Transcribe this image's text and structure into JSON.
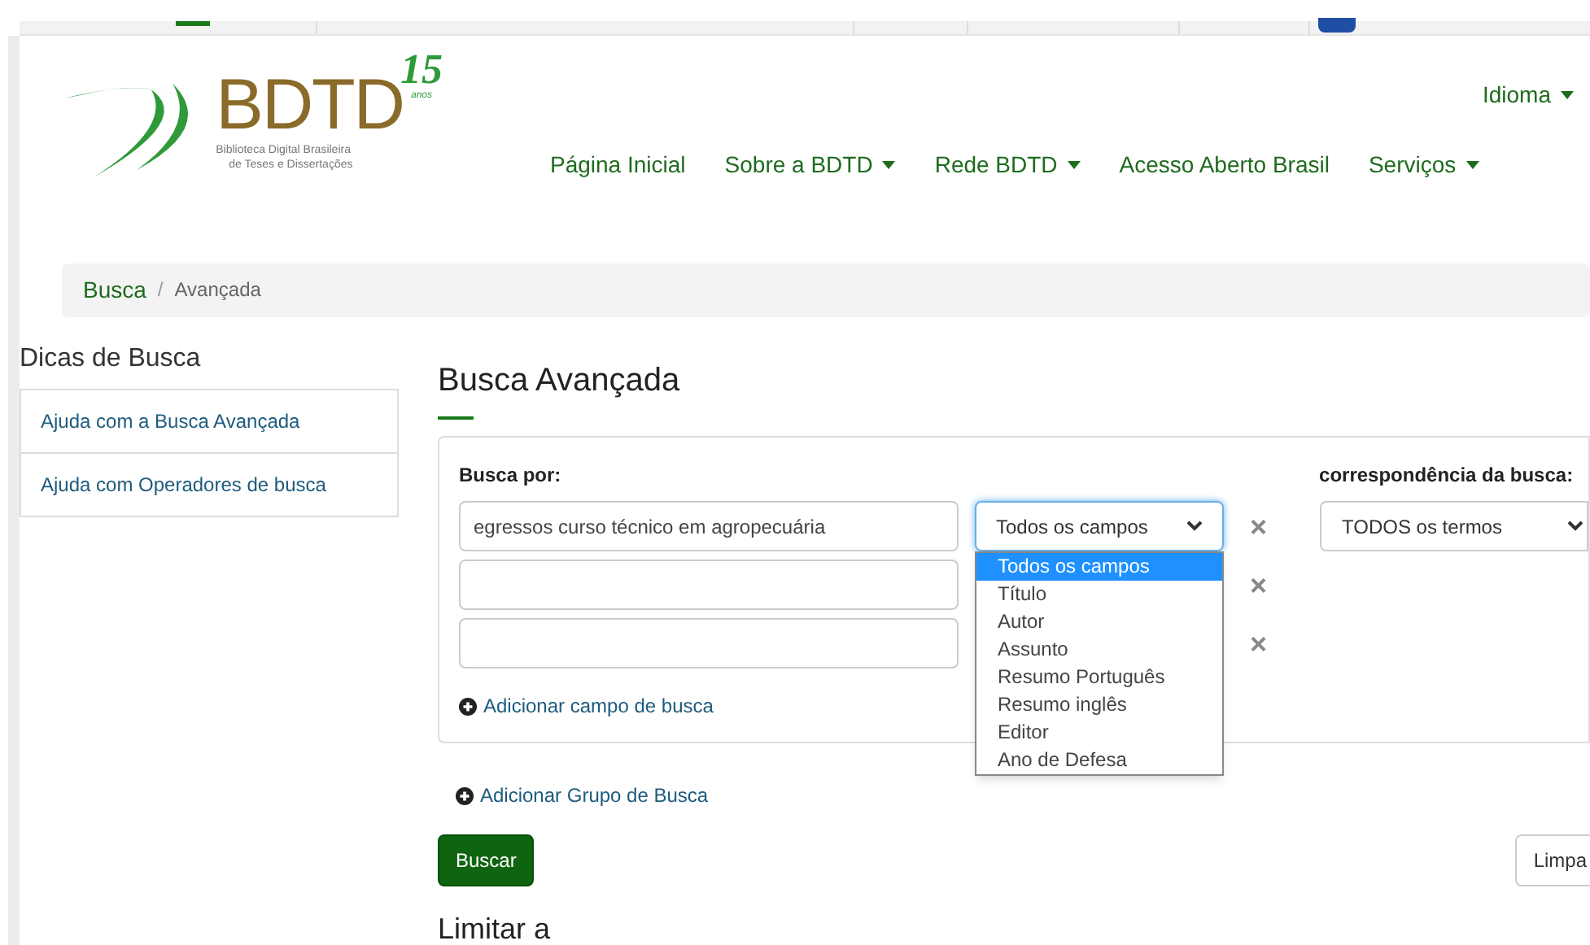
{
  "logo": {
    "name": "BDTD",
    "anniversary": "15",
    "anniversary_word": "anos",
    "subtitle_1": "Biblioteca Digital Brasileira",
    "subtitle_2": "de Teses e Dissertações"
  },
  "language_menu": {
    "label": "Idioma"
  },
  "nav": [
    {
      "label": "Página Inicial",
      "dropdown": false
    },
    {
      "label": "Sobre a BDTD",
      "dropdown": true
    },
    {
      "label": "Rede BDTD",
      "dropdown": true
    },
    {
      "label": "Acesso Aberto Brasil",
      "dropdown": false
    },
    {
      "label": "Serviços",
      "dropdown": true
    }
  ],
  "breadcrumb_separator": "/",
  "breadcrumb": [
    {
      "label": "Busca",
      "link": true
    },
    {
      "label": "Avançada",
      "link": false
    }
  ],
  "sidebar": {
    "title": "Dicas de Busca",
    "items": [
      "Ajuda com a Busca Avançada",
      "Ajuda com Operadores de busca"
    ]
  },
  "main": {
    "title": "Busca Avançada",
    "search_label": "Busca por:",
    "terms": [
      {
        "value": "egressos curso técnico em agropecuária",
        "field": "Todos os campos",
        "open": true,
        "removable": true
      },
      {
        "removable": true
      },
      {
        "removable": true
      }
    ],
    "field_options": [
      {
        "label": "Todos os campos",
        "selected": true
      },
      {
        "label": "Título",
        "selected": false
      },
      {
        "label": "Autor",
        "selected": false
      },
      {
        "label": "Assunto",
        "selected": false
      },
      {
        "label": "Resumo Português",
        "selected": false
      },
      {
        "label": "Resumo inglês",
        "selected": false
      },
      {
        "label": "Editor",
        "selected": false
      },
      {
        "label": "Ano de Defesa",
        "selected": false
      }
    ],
    "match_label": "correspondência da busca:",
    "match_value": "TODOS os termos",
    "remove_symbol": "×",
    "add_field": "Adicionar campo de busca",
    "add_group": "Adicionar Grupo de Busca",
    "search_button": "Buscar",
    "clear_button": "Limpa",
    "limit_title": "Limitar a"
  }
}
